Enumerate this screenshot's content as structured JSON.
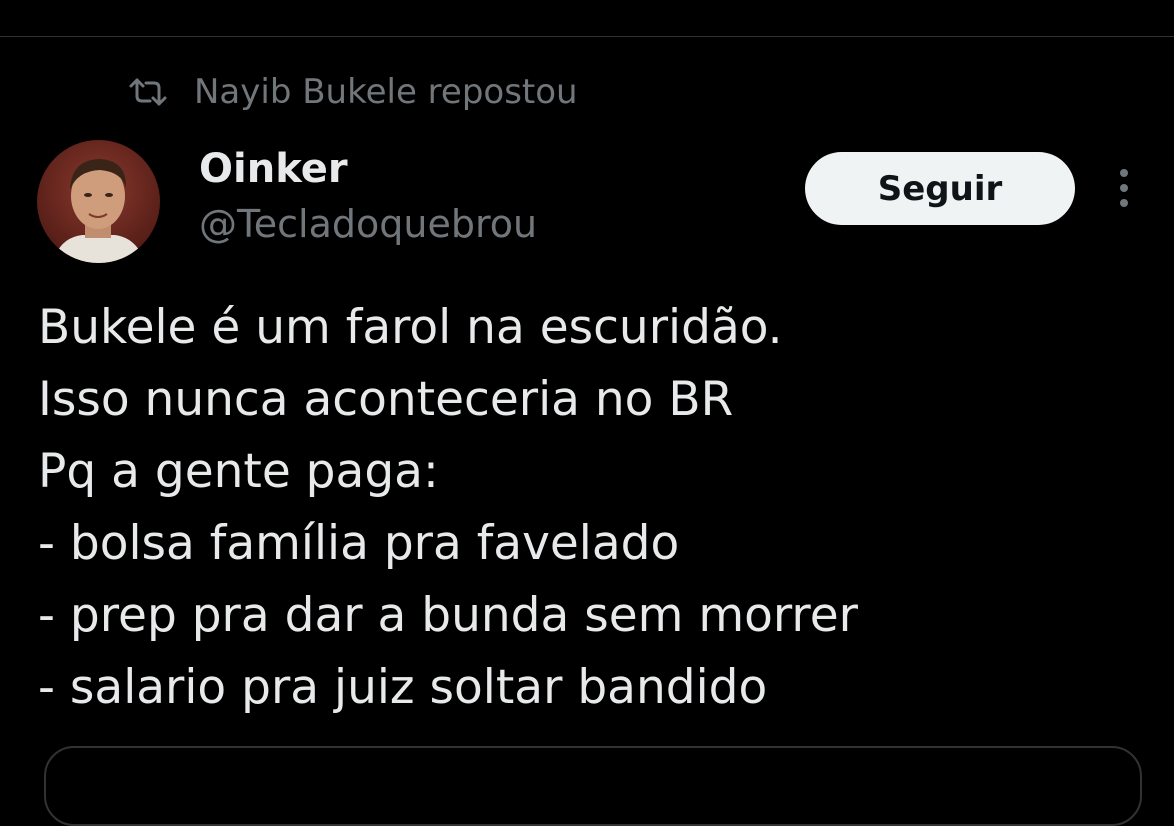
{
  "repost": {
    "icon": "repost-icon",
    "label": "Nayib Bukele repostou"
  },
  "author": {
    "display_name": "Oinker",
    "handle": "@Tecladoquebrou",
    "avatar": "user-avatar"
  },
  "actions": {
    "follow_label": "Seguir",
    "more_icon": "more-vertical-icon"
  },
  "tweet": {
    "lines": [
      "Bukele é um farol na escuridão.",
      "Isso nunca aconteceria no BR",
      "Pq a gente paga:",
      "- bolsa família pra favelado",
      "- prep pra dar a bunda sem morrer",
      "- salario pra juiz soltar bandido"
    ]
  },
  "colors": {
    "background": "#000000",
    "primary_text": "#e7e9ea",
    "secondary_text": "#71767b",
    "follow_button_bg": "#eff3f4",
    "follow_button_text": "#0f1419",
    "divider": "#2f3336"
  }
}
